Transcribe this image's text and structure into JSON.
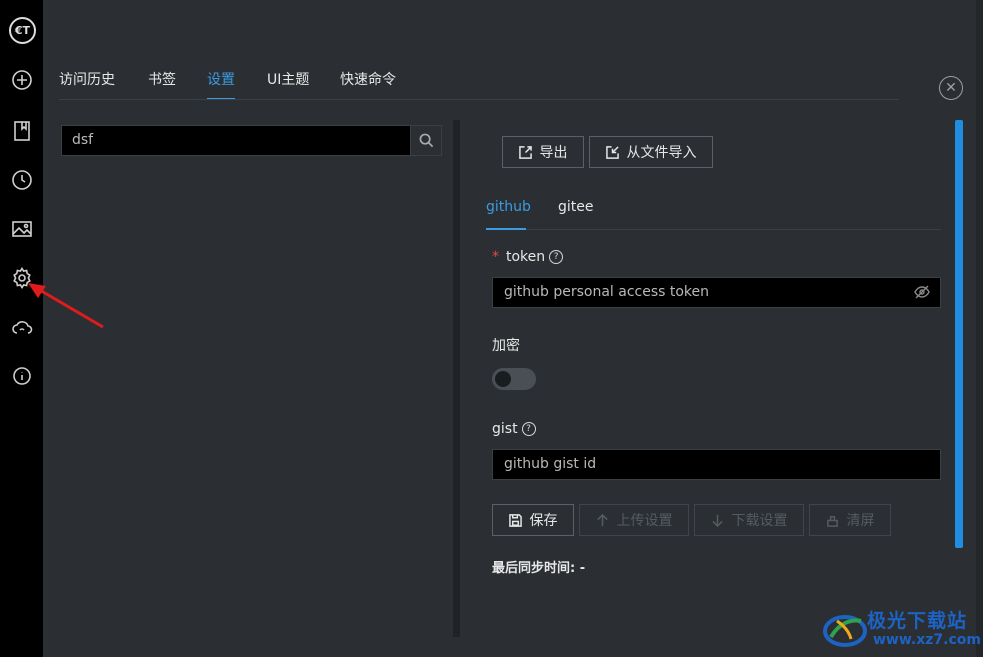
{
  "rail": {
    "logo": "€T",
    "items": [
      "add-circle",
      "bookmark",
      "history-clock",
      "image",
      "settings-gear",
      "cloud-sync",
      "info"
    ]
  },
  "tabs": [
    "访问历史",
    "书签",
    "设置",
    "UI主题",
    "快速命令"
  ],
  "active_tab": "设置",
  "search": {
    "value": "dsf"
  },
  "toolbar": {
    "export_label": "导出",
    "import_label": "从文件导入"
  },
  "subtabs": [
    "github",
    "gitee"
  ],
  "form": {
    "token_label": "token",
    "token_placeholder": "github personal access token",
    "encrypt_label": "加密",
    "encrypt_on": false,
    "gist_label": "gist",
    "gist_placeholder": "github gist id"
  },
  "actions": {
    "save": "保存",
    "upload": "上传设置",
    "download": "下载设置",
    "clear": "清屏"
  },
  "last_sync": "最后同步时间: -",
  "watermark": {
    "text": "极光下载站",
    "url": "www.xz7.com"
  },
  "colors": {
    "accent": "#3a9be0",
    "rail_bg": "#000000",
    "panel_bg": "#2b2f33"
  }
}
